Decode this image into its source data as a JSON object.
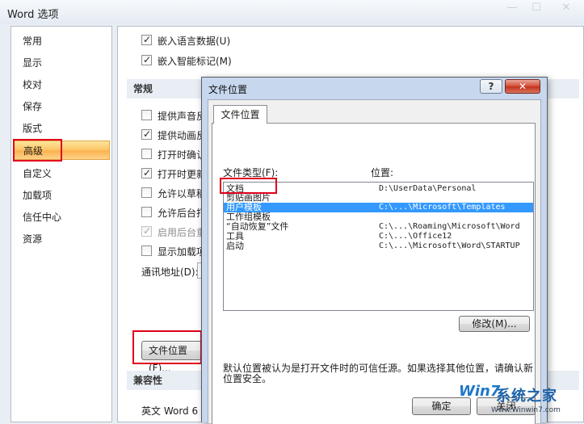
{
  "window": {
    "title": "Word 选项",
    "min_glyph": "—",
    "max_glyph": "☐",
    "close_glyph": "✕"
  },
  "sidebar": {
    "items": [
      {
        "label": "常用"
      },
      {
        "label": "显示"
      },
      {
        "label": "校对"
      },
      {
        "label": "保存"
      },
      {
        "label": "版式"
      },
      {
        "label": "高级"
      },
      {
        "label": "自定义"
      },
      {
        "label": "加载项"
      },
      {
        "label": "信任中心"
      },
      {
        "label": "资源"
      }
    ],
    "selected": "高级"
  },
  "content": {
    "top_options": [
      {
        "label": "嵌入语言数据(U)",
        "checked": true
      },
      {
        "label": "嵌入智能标记(M)",
        "checked": true
      }
    ],
    "section_general": "常规",
    "general_options": [
      {
        "label": "提供声音反",
        "checked": false,
        "disabled": false
      },
      {
        "label": "提供动画反",
        "checked": true,
        "disabled": false
      },
      {
        "label": "打开时确认",
        "checked": false,
        "disabled": false
      },
      {
        "label": "打开时更新",
        "checked": true,
        "disabled": false
      },
      {
        "label": "允许以草稿",
        "checked": false,
        "disabled": false
      },
      {
        "label": "允许后台打",
        "checked": false,
        "disabled": false
      },
      {
        "label": "启用后台重",
        "checked": true,
        "disabled": true
      },
      {
        "label": "显示加载项",
        "checked": false,
        "disabled": false
      }
    ],
    "mailing_address_label": "通讯地址(D):",
    "file_locations_button": "文件位置(F)...",
    "section_compat": "兼容性",
    "compat_label": "英文 Word 6"
  },
  "dialog": {
    "title": "文件位置",
    "help_glyph": "?",
    "close_glyph": "✕",
    "tab": "文件位置",
    "col_type": "文件类型(F):",
    "col_location": "位置:",
    "rows": [
      {
        "type": "文档",
        "location": "D:\\UserData\\Personal"
      },
      {
        "type": "剪贴画图片",
        "location": ""
      },
      {
        "type": "用户模板",
        "location": "C:\\...\\Microsoft\\Templates"
      },
      {
        "type": "工作组模板",
        "location": ""
      },
      {
        "type": "“自动恢复”文件",
        "location": "C:\\...\\Roaming\\Microsoft\\Word"
      },
      {
        "type": "工具",
        "location": "C:\\...\\Office12"
      },
      {
        "type": "启动",
        "location": "C:\\...\\Microsoft\\Word\\STARTUP"
      }
    ],
    "selected_row": "用户模板",
    "modify_button": "修改(M)...",
    "note": "默认位置被认为是打开文件时的可信任源。如果选择其他位置，请确认新位置安全。",
    "ok_button": "确定",
    "close_button": "关闭"
  },
  "watermark": {
    "logo": "Win7",
    "text": "系统之家",
    "url": "Www.Winwin7.com"
  },
  "colors": {
    "selection_blue": "#3399ff",
    "highlight_red": "#e0001b",
    "active_nav_orange": "#fbb351"
  }
}
